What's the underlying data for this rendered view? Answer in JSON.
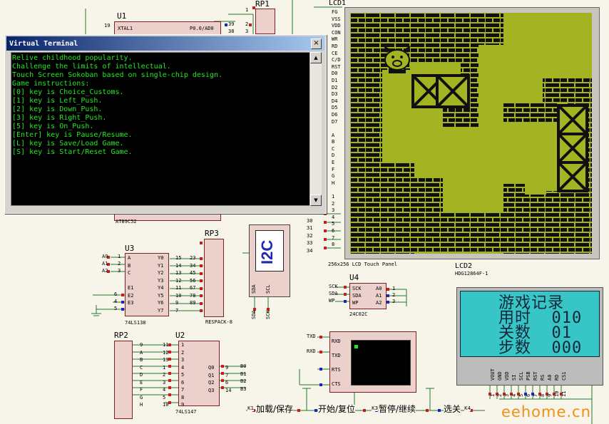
{
  "u1": {
    "ref": "U1",
    "part": "AT89C52",
    "p19": "19",
    "xtal1": "XTAL1",
    "p0ad0": "P0.0/AD0"
  },
  "rp1": {
    "ref": "RP1",
    "p1": "1",
    "p2": "2",
    "p3": "3",
    "p4": "4",
    "v39": "39",
    "v38": "38",
    "v37": "37"
  },
  "terminal": {
    "title": "Virtual Terminal",
    "close": "×",
    "lines": [
      "Relive childhood popularity.",
      "Challenge the limits of intellectual.",
      "Touch Screen Sokoban based on single-chip design.",
      "Game instructions:",
      "[0] key is Choice_Customs.",
      "[1] key is Left_Push.",
      "[2] key is Down_Push.",
      "[3] key is Right_Push.",
      "[5] key is On_Push.",
      "[Enter] key is Pause/Resume.",
      "[L] key is Save/Load Game.",
      "[S] key is Start/Reset Game."
    ]
  },
  "lcd1": {
    "ref": "LCD1",
    "caption": "256x256 LCD Touch Panel",
    "pins": [
      "FG",
      "VSS",
      "VDD",
      "CON",
      "WR",
      "RD",
      "CE",
      "C/D",
      "RST",
      "D0",
      "D1",
      "D2",
      "D3",
      "D4",
      "D5",
      "D6",
      "D7",
      "",
      "A",
      "B",
      "C",
      "D",
      "E",
      "F",
      "G",
      "H",
      "",
      "1",
      "2",
      "3",
      "4",
      "5",
      "6",
      "7",
      "8"
    ]
  },
  "lcd2": {
    "ref": "LCD2",
    "part": "HDG12864F-1",
    "rows": [
      "游戏记录",
      "用时  010",
      "关数  01",
      "步数  000"
    ],
    "pins": [
      "VOUT",
      "GND",
      "VDD",
      "SI",
      "SCL",
      "PSB",
      "RST",
      "RS",
      "A0",
      "RD",
      "CS1"
    ],
    "nums": [
      "1",
      "2",
      "3",
      "4",
      "5",
      "6",
      "7",
      "8",
      "9",
      "10",
      "11"
    ]
  },
  "u3": {
    "ref": "U3",
    "part": "74LS138",
    "inputs": [
      "A0",
      "A1",
      "A2"
    ],
    "in_nums": [
      "1",
      "2",
      "3"
    ],
    "pins_l": [
      "A",
      "B",
      "C",
      "",
      "E1",
      "E2",
      "E3"
    ],
    "pins_r": [
      "Y0",
      "Y1",
      "Y2",
      "Y3",
      "Y4",
      "Y5",
      "Y6",
      "Y7"
    ],
    "nums_r": [
      "15",
      "14",
      "13",
      "12",
      "11",
      "10",
      "9",
      "7"
    ],
    "nums_e": [
      "6",
      "4",
      "5"
    ]
  },
  "rp3": {
    "ref": "RP3",
    "part": "RESPACK-8",
    "nums_l": [
      "1",
      "2",
      "3",
      "4",
      "5",
      "6",
      "7",
      "8"
    ],
    "nums_r": [
      "23",
      "34",
      "45",
      "56",
      "67",
      "78",
      "89"
    ]
  },
  "i2c": {
    "label": "I2C",
    "sda": "SDA",
    "scl": "SCL",
    "sda_tag": "SDA",
    "scl_tag": "SCK"
  },
  "u4": {
    "ref": "U4",
    "part": "24C02C",
    "in": [
      "SCK",
      "SDA",
      "WP"
    ],
    "in_nums": [
      "6",
      "5",
      "7"
    ],
    "pins_l": [
      "SCK",
      "SDA",
      "WP"
    ],
    "pins_r": [
      "A0",
      "A1",
      "A2"
    ],
    "nums_r": [
      "1",
      "2",
      "3"
    ]
  },
  "rp2": {
    "ref": "RP2",
    "part": "RESPACK-8"
  },
  "u2": {
    "ref": "U2",
    "part": "74LS147",
    "pins_l": [
      "1",
      "2",
      "3",
      "4",
      "5",
      "6",
      "7",
      "8",
      "9"
    ],
    "letters": [
      "9",
      "A",
      "B",
      "C",
      "D",
      "E",
      "F",
      "G",
      "H"
    ],
    "nums_l": [
      "11",
      "12",
      "13",
      "1",
      "2",
      "3",
      "4",
      "5",
      "10"
    ],
    "pins_r": [
      "Q0",
      "Q1",
      "Q2",
      "Q3"
    ],
    "nums_r": [
      "9",
      "7",
      "6",
      "14"
    ],
    "outs": [
      "B0",
      "B1",
      "B2",
      "B3"
    ]
  },
  "rs232": {
    "txd1": "TXD",
    "rxd1": "RXD",
    "rxd": "RXD",
    "txd": "TXD",
    "rts": "RTS",
    "cts": "CTS"
  },
  "u1pins": {
    "nums": [
      "29",
      "30",
      "31",
      "32",
      "33",
      "34"
    ]
  },
  "switches": {
    "k1": "K1",
    "k1_label": "加载/保存",
    "k2_label": "开始/复位",
    "k3": "K3",
    "k3_label": "暂停/继续",
    "k4_label": "选关",
    "k4": "K4"
  },
  "watermark": "eehome.cn"
}
